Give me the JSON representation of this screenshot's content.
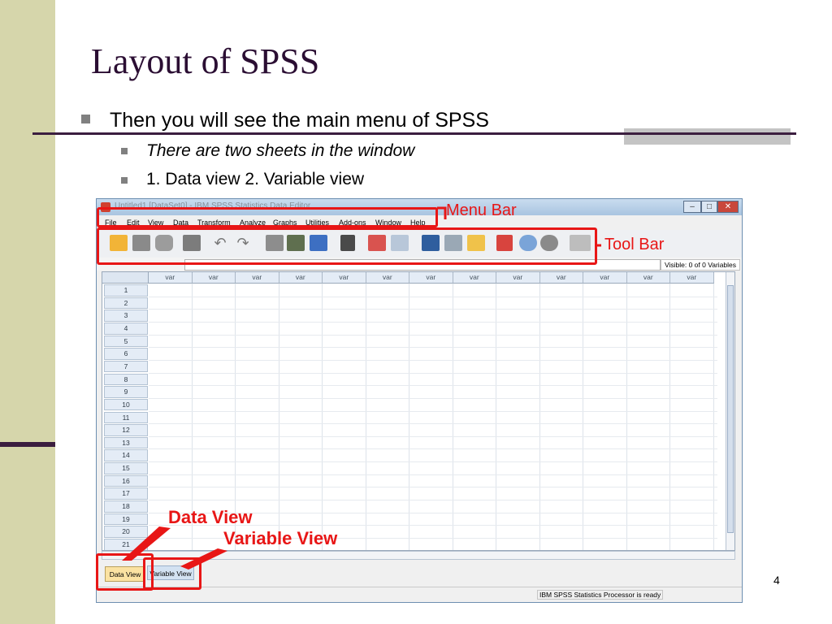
{
  "slide": {
    "title": "Layout of SPSS",
    "bullets": [
      {
        "text": "Then you will see the main menu of SPSS",
        "level": 1
      },
      {
        "text": "There are two sheets in the window",
        "level": 2,
        "italic": true
      },
      {
        "text": "1. Data view 2. Variable view",
        "level": 2
      }
    ],
    "page_number": "4"
  },
  "window": {
    "title": "Untitled1 [DataSet0] - IBM SPSS Statistics Data Editor",
    "controls": {
      "minimize": "–",
      "maximize": "□",
      "close": "✕"
    },
    "menus": [
      "File",
      "Edit",
      "View",
      "Data",
      "Transform",
      "Analyze",
      "Graphs",
      "Utilities",
      "Add-ons",
      "Window",
      "Help"
    ],
    "toolbar_icons": [
      "open-folder-icon",
      "save-icon",
      "print-icon",
      "dialog-recall-icon",
      "undo-icon",
      "redo-icon",
      "goto-case-icon",
      "goto-variable-icon",
      "variables-icon",
      "find-icon",
      "insert-cases-icon",
      "insert-variable-icon",
      "split-file-icon",
      "weight-cases-icon",
      "select-cases-icon",
      "value-labels-icon",
      "use-sets-icon",
      "show-all-variables-icon",
      "spell-check-icon"
    ],
    "visible_label": "Visible: 0 of 0 Variables",
    "column_headers": [
      "var",
      "var",
      "var",
      "var",
      "var",
      "var",
      "var",
      "var",
      "var",
      "var",
      "var",
      "var",
      "var"
    ],
    "row_numbers": [
      "1",
      "2",
      "3",
      "4",
      "5",
      "6",
      "7",
      "8",
      "9",
      "10",
      "11",
      "12",
      "13",
      "14",
      "15",
      "16",
      "17",
      "18",
      "19",
      "20",
      "21"
    ],
    "tabs": {
      "data_view": "Data View",
      "variable_view": "Variable View"
    },
    "status": "IBM SPSS Statistics Processor is ready"
  },
  "annotations": {
    "menu_bar": "Menu Bar",
    "tool_bar": "Tool Bar",
    "data_view": "Data View",
    "variable_view": "Variable View",
    "color": "#e81616"
  }
}
